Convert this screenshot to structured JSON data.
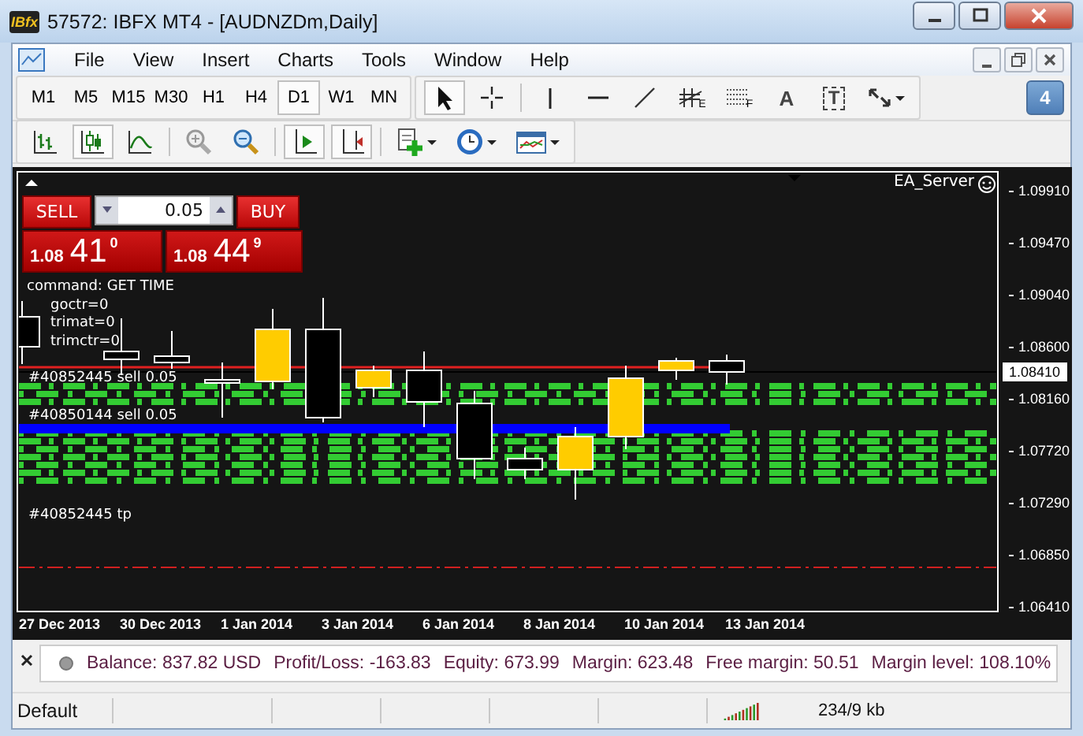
{
  "window": {
    "title": "57572: IBFX MT4 - [AUDNZDm,Daily]",
    "logo": "IBfx"
  },
  "menu": [
    "File",
    "View",
    "Insert",
    "Charts",
    "Tools",
    "Window",
    "Help"
  ],
  "timeframes": [
    {
      "label": "M1",
      "selected": false
    },
    {
      "label": "M5",
      "selected": false
    },
    {
      "label": "M15",
      "selected": false
    },
    {
      "label": "M30",
      "selected": false
    },
    {
      "label": "H1",
      "selected": false
    },
    {
      "label": "H4",
      "selected": false
    },
    {
      "label": "D1",
      "selected": true
    },
    {
      "label": "W1",
      "selected": false
    },
    {
      "label": "MN",
      "selected": false
    }
  ],
  "draw_tools": [
    {
      "kind": "cursor",
      "selected": true
    },
    {
      "kind": "crosshair",
      "selected": false
    },
    {
      "kind": "vline",
      "selected": false
    },
    {
      "kind": "hline",
      "selected": false
    },
    {
      "kind": "trend",
      "selected": false
    },
    {
      "kind": "fibo",
      "letter": "E",
      "selected": false
    },
    {
      "kind": "grid",
      "letter": "F",
      "selected": false
    },
    {
      "kind": "text",
      "letter": "A",
      "selected": false
    },
    {
      "kind": "label",
      "letter": "T",
      "selected": false
    },
    {
      "kind": "arrows",
      "selected": false
    }
  ],
  "notifications": "4",
  "chart_tools": [
    {
      "kind": "bars",
      "selected": false
    },
    {
      "kind": "candles",
      "selected": true
    },
    {
      "kind": "line",
      "selected": false
    },
    {
      "kind": "zoom-in",
      "selected": false
    },
    {
      "kind": "zoom-out",
      "selected": false
    },
    {
      "kind": "autoscroll",
      "selected": true
    },
    {
      "kind": "shift",
      "selected": true
    },
    {
      "kind": "indicator",
      "selected": false
    },
    {
      "kind": "periods",
      "selected": false
    },
    {
      "kind": "templates",
      "selected": false
    }
  ],
  "chart": {
    "ea_name": "EA_Server",
    "trade_panel": {
      "sell": {
        "label": "SELL",
        "price_prefix": "1.08",
        "price_pips": "41",
        "price_fraction": "0"
      },
      "lot": "0.05",
      "buy": {
        "label": "BUY",
        "price_prefix": "1.08",
        "price_pips": "44",
        "price_fraction": "9"
      }
    },
    "comment": [
      "command: GET TIME",
      "goctr=0",
      "trimat=0",
      "trimctr=0"
    ],
    "orders": [
      {
        "label": "#40852445 sell 0.05"
      },
      {
        "label": "#40850144 sell 0.05"
      },
      {
        "label": "#40852445 tp"
      }
    ],
    "price_axis": [
      "1.09910",
      "1.09470",
      "1.09040",
      "1.08600",
      "1.08160",
      "1.07720",
      "1.07290",
      "1.06850",
      "1.06410"
    ],
    "current_price": "1.08410",
    "dates": [
      "27 Dec 2013",
      "30 Dec 2013",
      "1 Jan 2014",
      "3 Jan 2014",
      "6 Jan 2014",
      "8 Jan 2014",
      "10 Jan 2014",
      "13 Jan 2014"
    ]
  },
  "terminal": {
    "items": [
      "Balance: 837.82 USD",
      "Profit/Loss: -163.83",
      "Equity: 673.99",
      "Margin: 623.48",
      "Free margin: 50.51",
      "Margin level: 108.10%"
    ]
  },
  "status_bar": {
    "profile": "Default",
    "traffic": "234/9 kb"
  }
}
